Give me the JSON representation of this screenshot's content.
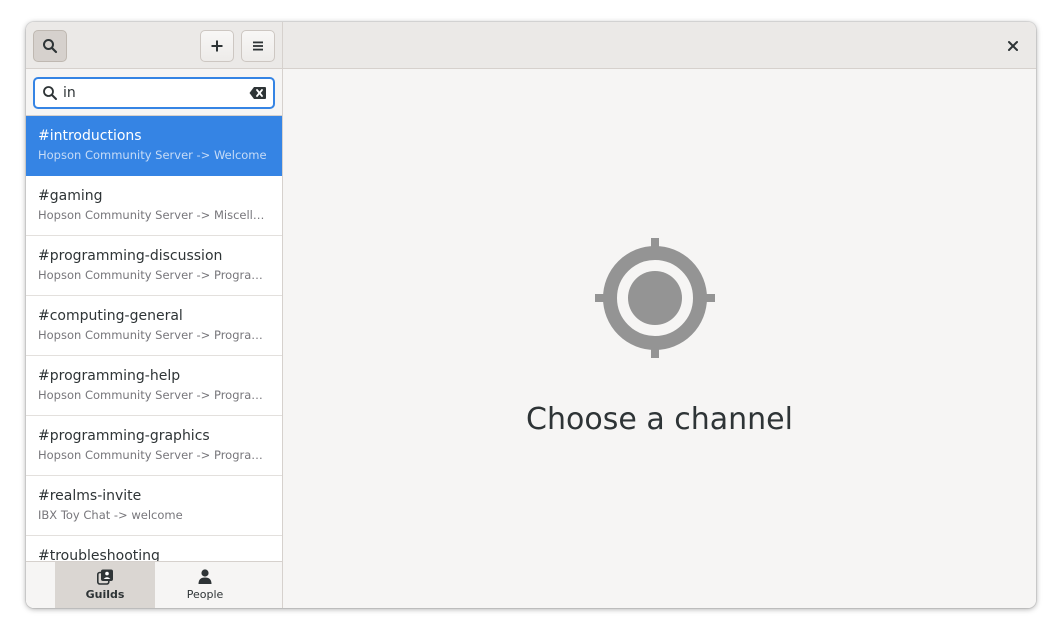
{
  "header": {
    "search_icon": "search-icon",
    "add_icon": "plus-icon",
    "menu_icon": "hamburger-menu-icon",
    "close_icon": "close-icon"
  },
  "search": {
    "value": "in",
    "placeholder": ""
  },
  "channels": [
    {
      "name": "#introductions",
      "path": "Hopson Community Server -> Welcome",
      "selected": true
    },
    {
      "name": "#gaming",
      "path": "Hopson Community Server -> Miscellaneous"
    },
    {
      "name": "#programming-discussion",
      "path": "Hopson Community Server -> Programming"
    },
    {
      "name": "#computing-general",
      "path": "Hopson Community Server -> Programming"
    },
    {
      "name": "#programming-help",
      "path": "Hopson Community Server -> Programming"
    },
    {
      "name": "#programming-graphics",
      "path": "Hopson Community Server -> Programming"
    },
    {
      "name": "#realms-invite",
      "path": "IBX Toy Chat -> welcome"
    },
    {
      "name": "#troubleshooting",
      "path": ""
    }
  ],
  "switcher": {
    "guilds_label": "Guilds",
    "people_label": "People"
  },
  "main": {
    "placeholder_title": "Choose a channel",
    "placeholder_icon": "target-crosshair-icon"
  },
  "colors": {
    "accent": "#3584e4",
    "icon_gray": "#949494"
  }
}
